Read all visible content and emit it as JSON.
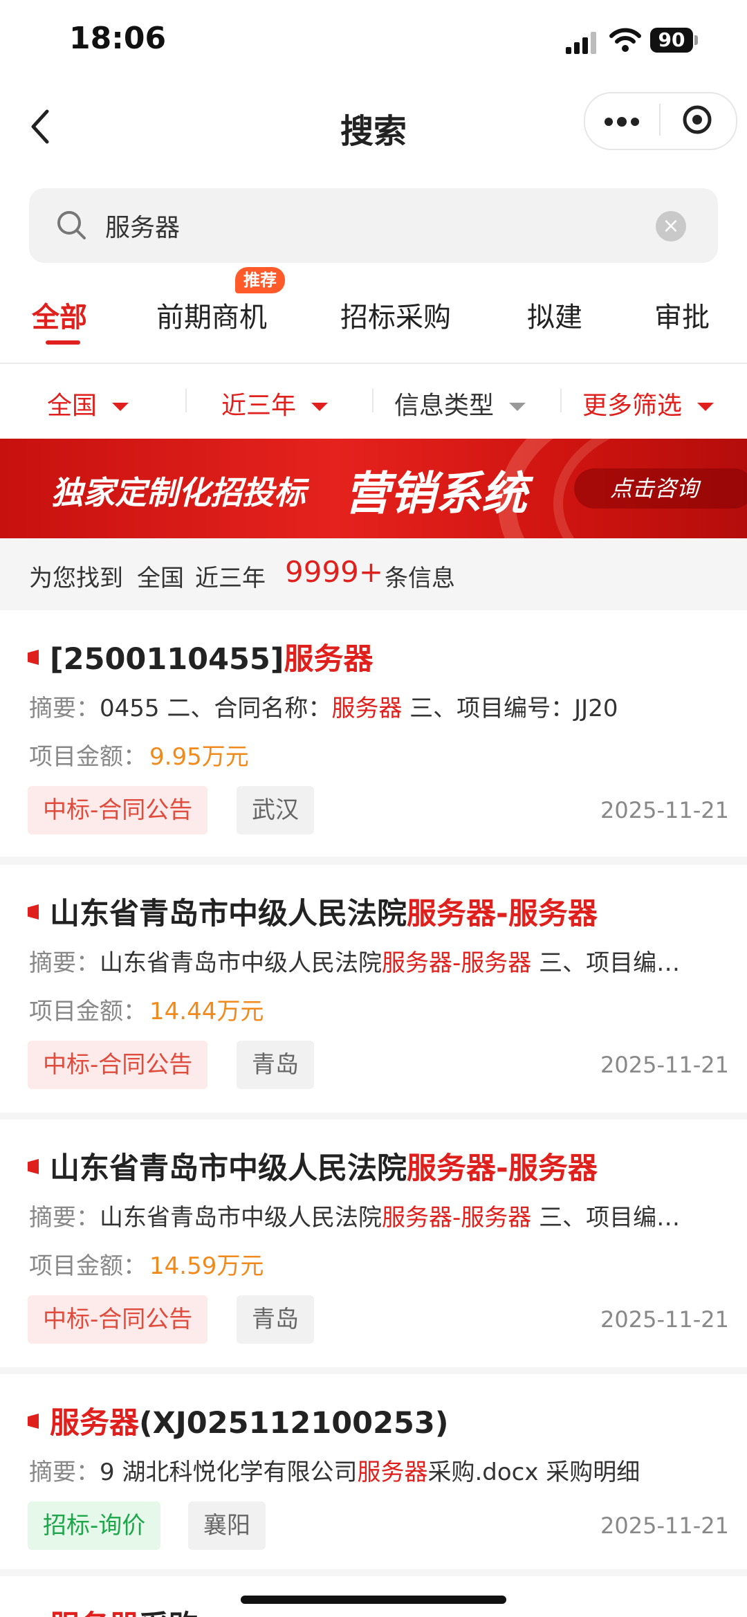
{
  "status_bar": {
    "time": "18:06",
    "battery": "90"
  },
  "nav": {
    "title": "搜索"
  },
  "search": {
    "query": "服务器"
  },
  "tabs": [
    {
      "label": "全部"
    },
    {
      "label": "前期商机",
      "badge": "推荐"
    },
    {
      "label": "招标采购"
    },
    {
      "label": "拟建"
    },
    {
      "label": "审批"
    }
  ],
  "filters": [
    {
      "label": "全国"
    },
    {
      "label": "近三年"
    },
    {
      "label": "信息类型"
    },
    {
      "label": "更多筛选"
    }
  ],
  "banner": {
    "text_left": "独家定制化招投标",
    "text_main": "营销系统",
    "button": "点击咨询"
  },
  "summary": {
    "prefix": "为您找到",
    "region": "全国",
    "period": "近三年",
    "count": "9999+",
    "suffix": "条信息"
  },
  "results": [
    {
      "title_plain": "[2500110455]",
      "title_hl": "服务器",
      "title_tail": "",
      "abstract_label": "摘要：",
      "abstract_pre": "0455 二、合同名称：",
      "abstract_hl": "服务器",
      "abstract_post": " 三、项目编号：JJ20",
      "amount_label": "项目金额：",
      "amount": "9.95万元",
      "tags": [
        "中标-合同公告",
        "武汉"
      ],
      "date": "2025-11-21"
    },
    {
      "title_plain": "山东省青岛市中级人民法院",
      "title_hl": "服务器-服务器",
      "title_tail": "",
      "abstract_label": "摘要：",
      "abstract_pre": "山东省青岛市中级人民法院",
      "abstract_hl": "服务器-服务器",
      "abstract_post": " 三、项目编…",
      "amount_label": "项目金额：",
      "amount": "14.44万元",
      "tags": [
        "中标-合同公告",
        "青岛"
      ],
      "date": "2025-11-21"
    },
    {
      "title_plain": "山东省青岛市中级人民法院",
      "title_hl": "服务器-服务器",
      "title_tail": "",
      "abstract_label": "摘要：",
      "abstract_pre": "山东省青岛市中级人民法院",
      "abstract_hl": "服务器-服务器",
      "abstract_post": " 三、项目编…",
      "amount_label": "项目金额：",
      "amount": "14.59万元",
      "tags": [
        "中标-合同公告",
        "青岛"
      ],
      "date": "2025-11-21"
    },
    {
      "title_plain": "",
      "title_hl": "服务器",
      "title_tail": "(XJ025112100253)",
      "abstract_label": "摘要：",
      "abstract_pre": "9 湖北科悦化学有限公司",
      "abstract_hl": "服务器",
      "abstract_post": "采购.docx 采购明细",
      "tags": [
        "招标-询价",
        "襄阳"
      ],
      "date": "2025-11-21"
    },
    {
      "title_hl": "服务器",
      "title_tail": "采购"
    }
  ],
  "colors": {
    "accent": "#e0201c",
    "amount": "#f08a1c",
    "tag_green": "#1ea64a"
  }
}
